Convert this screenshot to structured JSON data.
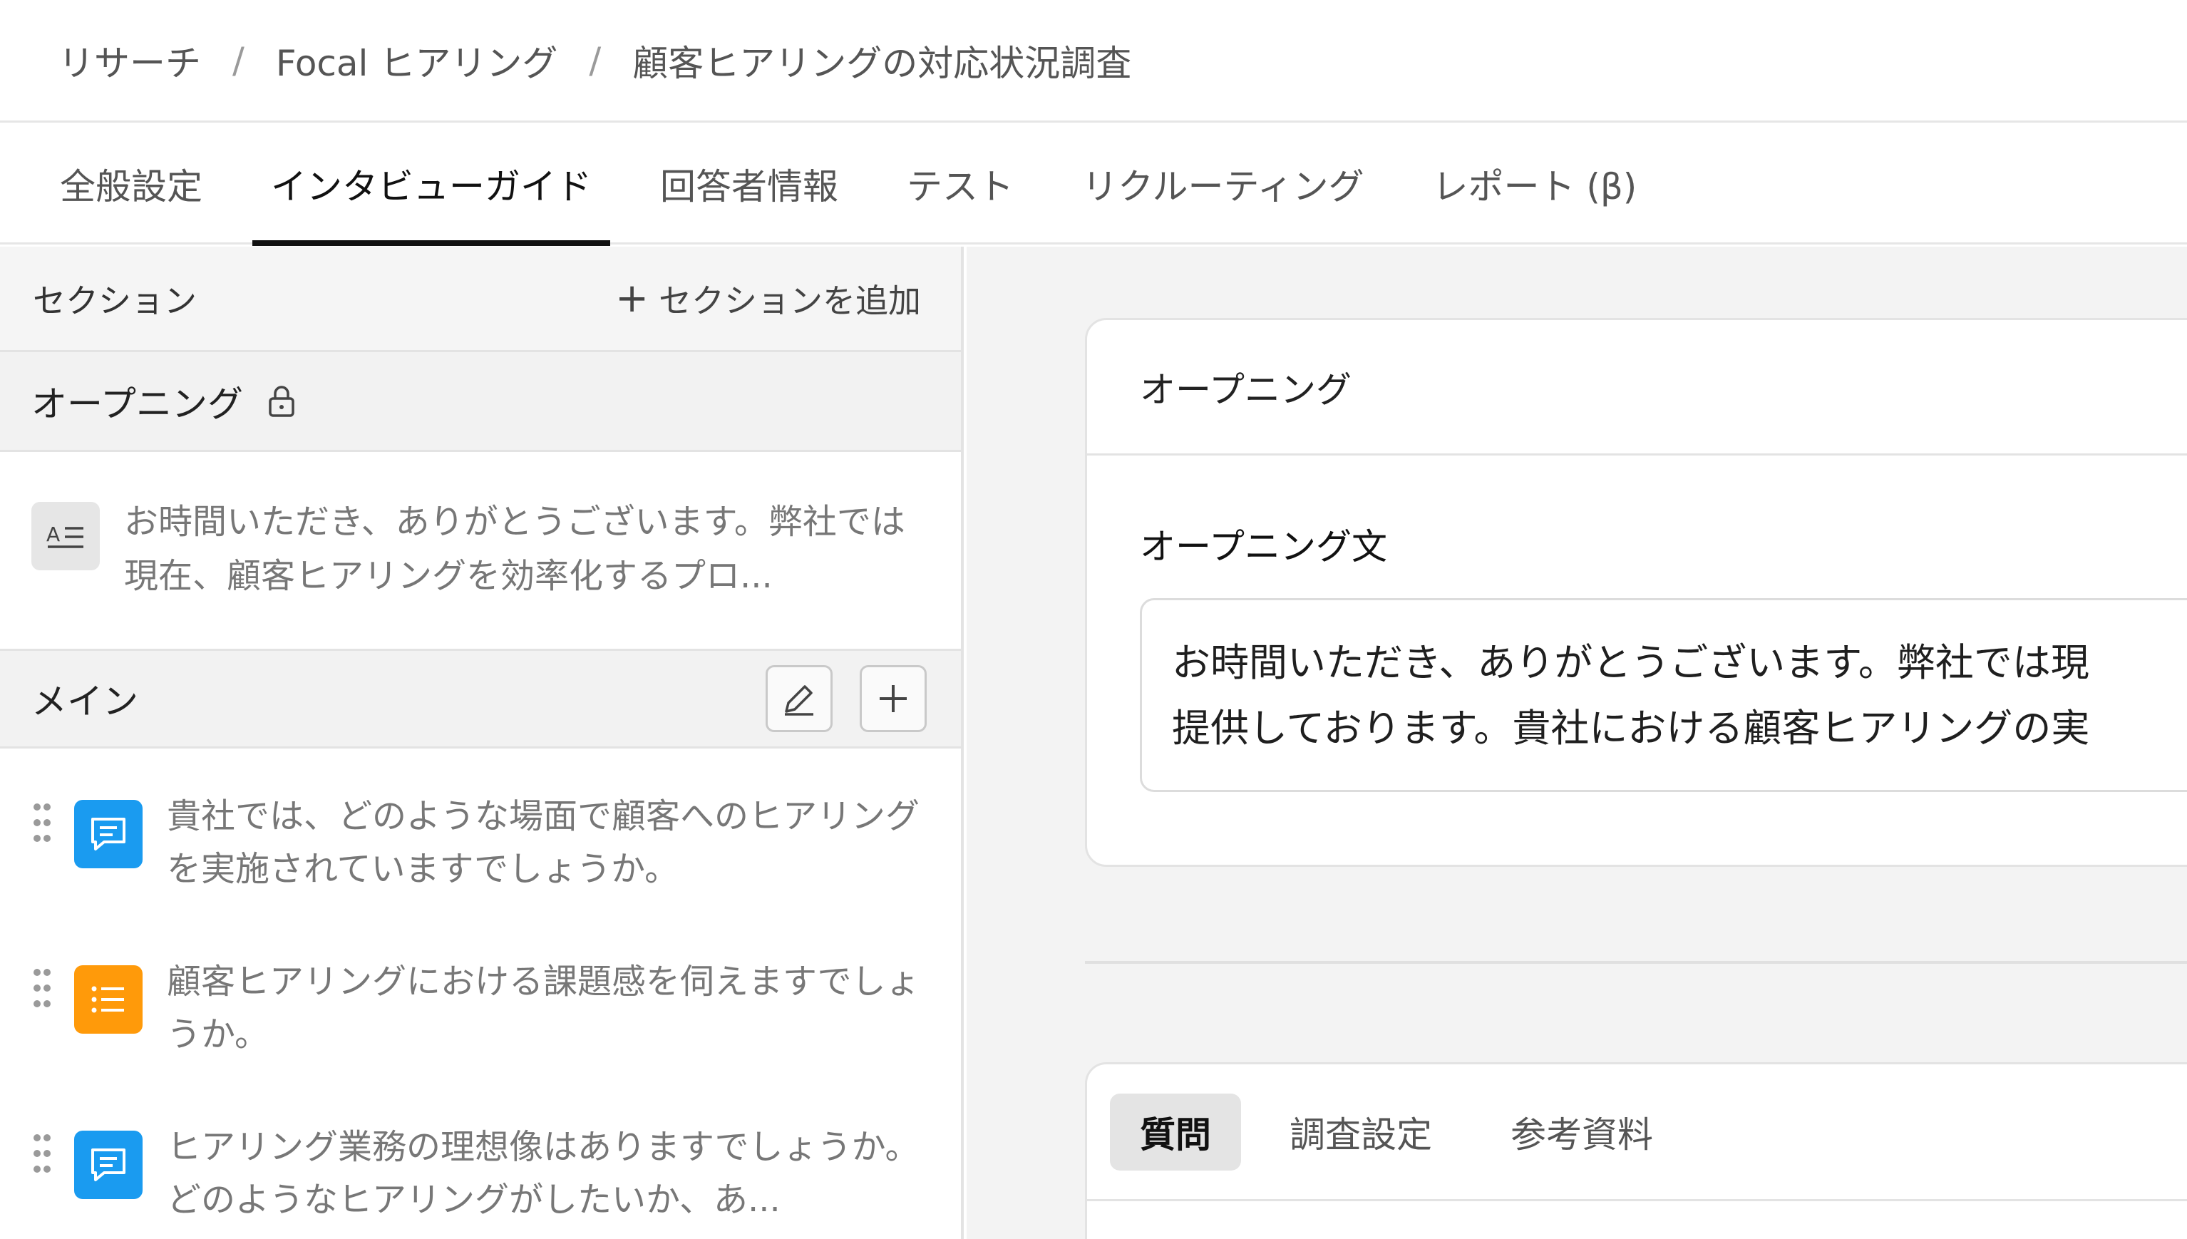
{
  "breadcrumb": {
    "items": [
      "リサーチ",
      "Focal ヒアリング",
      "顧客ヒアリングの対応状況調査"
    ],
    "separator": "/"
  },
  "tabs": [
    {
      "label": "全般設定",
      "active": false
    },
    {
      "label": "インタビューガイド",
      "active": true
    },
    {
      "label": "回答者情報",
      "active": false
    },
    {
      "label": "テスト",
      "active": false
    },
    {
      "label": "リクルーティング",
      "active": false
    },
    {
      "label": "レポート (β)",
      "active": false
    }
  ],
  "sidebar": {
    "header_label": "セクション",
    "add_section_label": "セクションを追加",
    "opening": {
      "label": "オープニング",
      "item_text": "お時間いただき、ありがとうございます。弊社では現在、顧客ヒアリングを効率化するプロ..."
    },
    "main": {
      "label": "メイン",
      "questions": [
        {
          "text": "貴社では、どのような場面で顧客へのヒアリングを実施されていますでしょうか。",
          "icon": "chat-icon",
          "color": "#1a9bf0"
        },
        {
          "text": "顧客ヒアリングにおける課題感を伺えますでしょうか。",
          "icon": "list-icon",
          "color": "#ff9a0a"
        },
        {
          "text": "ヒアリング業務の理想像はありますでしょうか。どのようなヒアリングがしたいか、あ...",
          "icon": "chat-icon",
          "color": "#1a9bf0"
        }
      ]
    }
  },
  "editor": {
    "card_title": "オープニング",
    "field_label": "オープニング文",
    "field_value_lines": [
      "お時間いただき、ありがとうございます。弊社では現",
      "提供しております。貴社における顧客ヒアリングの実"
    ],
    "subtabs": [
      {
        "label": "質問",
        "active": true
      },
      {
        "label": "調査設定",
        "active": false
      },
      {
        "label": "参考資料",
        "active": false
      }
    ]
  }
}
